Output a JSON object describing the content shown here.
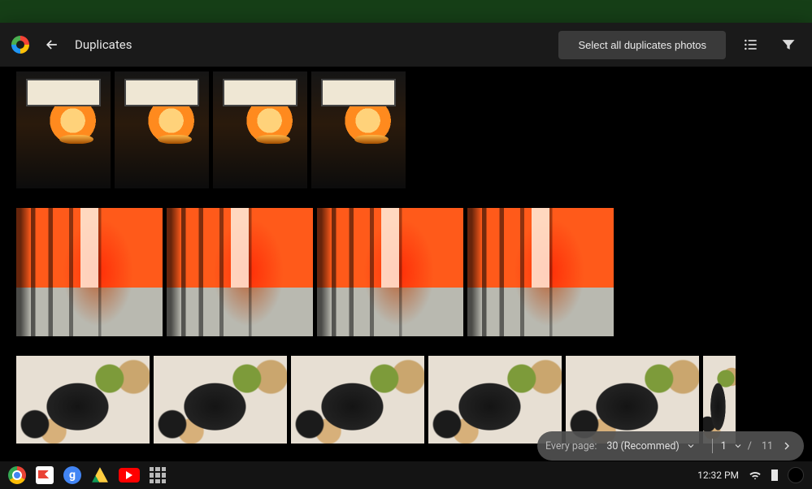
{
  "header": {
    "title": "Duplicates",
    "select_all_label": "Select all duplicates photos"
  },
  "groups": [
    {
      "kind": "lantern",
      "count": 4
    },
    {
      "kind": "torii",
      "count": 4
    },
    {
      "kind": "food",
      "count": 6
    }
  ],
  "pager": {
    "every_page_label": "Every page:",
    "page_size_label": "30 (Recommed)",
    "current_page": "1",
    "page_sep": "/",
    "total_pages": "11"
  },
  "taskbar": {
    "clock": "12:32 PM"
  }
}
